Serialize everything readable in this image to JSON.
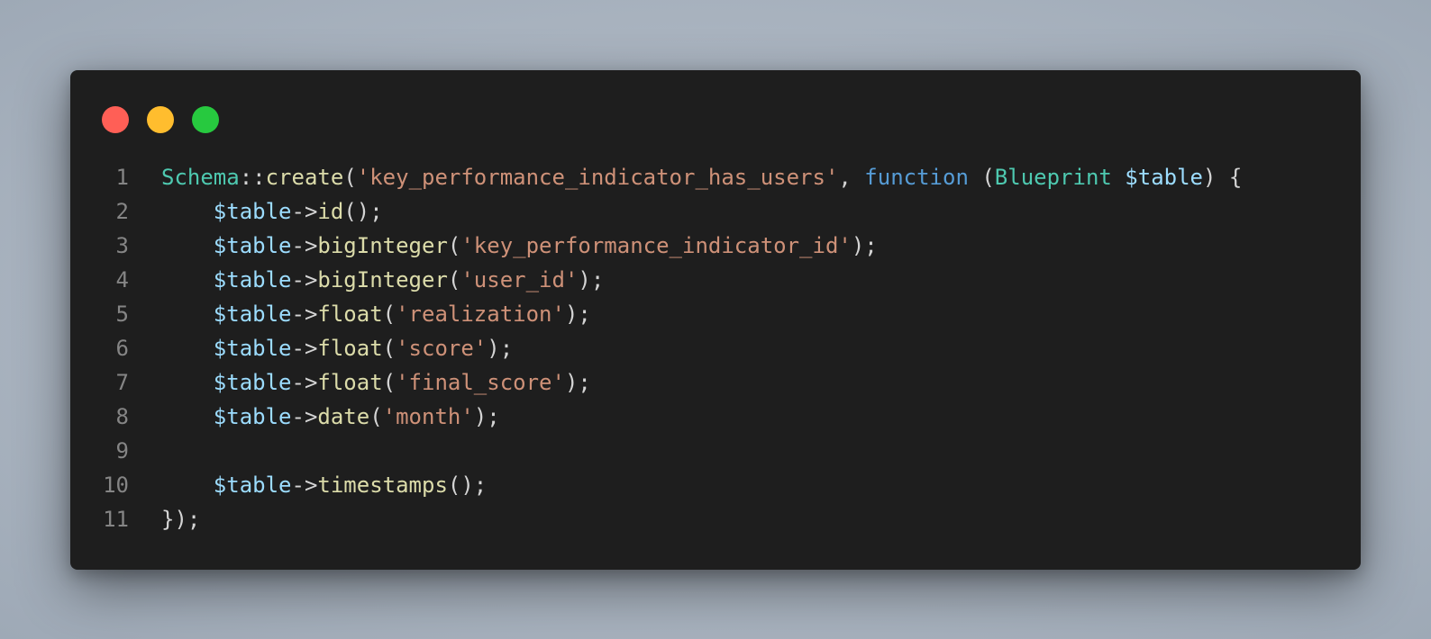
{
  "window": {
    "controls": [
      {
        "name": "close",
        "color": "#ff5f56"
      },
      {
        "name": "minimize",
        "color": "#ffbd2e"
      },
      {
        "name": "maximize",
        "color": "#27c93f"
      }
    ]
  },
  "colors": {
    "background": "#1e1e1e",
    "class": "#4ec9b0",
    "function": "#dcdcaa",
    "string": "#ce9178",
    "keyword": "#569cd6",
    "variable": "#9cdcfe",
    "punctuation": "#d4d4d4",
    "line_number": "#858585"
  },
  "code": {
    "lines": [
      {
        "number": "1",
        "tokens": [
          {
            "t": "class",
            "v": "Schema"
          },
          {
            "t": "punct",
            "v": "::"
          },
          {
            "t": "func",
            "v": "create"
          },
          {
            "t": "punct",
            "v": "("
          },
          {
            "t": "str",
            "v": "'key_performance_indicator_has_users'"
          },
          {
            "t": "punct",
            "v": ", "
          },
          {
            "t": "kw",
            "v": "function"
          },
          {
            "t": "punct",
            "v": " ("
          },
          {
            "t": "class",
            "v": "Blueprint"
          },
          {
            "t": "punct",
            "v": " "
          },
          {
            "t": "var",
            "v": "$table"
          },
          {
            "t": "punct",
            "v": ") {"
          }
        ]
      },
      {
        "number": "2",
        "tokens": [
          {
            "t": "punct",
            "v": "    "
          },
          {
            "t": "var",
            "v": "$table"
          },
          {
            "t": "punct",
            "v": "->"
          },
          {
            "t": "func",
            "v": "id"
          },
          {
            "t": "punct",
            "v": "();"
          }
        ]
      },
      {
        "number": "3",
        "tokens": [
          {
            "t": "punct",
            "v": "    "
          },
          {
            "t": "var",
            "v": "$table"
          },
          {
            "t": "punct",
            "v": "->"
          },
          {
            "t": "func",
            "v": "bigInteger"
          },
          {
            "t": "punct",
            "v": "("
          },
          {
            "t": "str",
            "v": "'key_performance_indicator_id'"
          },
          {
            "t": "punct",
            "v": ");"
          }
        ]
      },
      {
        "number": "4",
        "tokens": [
          {
            "t": "punct",
            "v": "    "
          },
          {
            "t": "var",
            "v": "$table"
          },
          {
            "t": "punct",
            "v": "->"
          },
          {
            "t": "func",
            "v": "bigInteger"
          },
          {
            "t": "punct",
            "v": "("
          },
          {
            "t": "str",
            "v": "'user_id'"
          },
          {
            "t": "punct",
            "v": ");"
          }
        ]
      },
      {
        "number": "5",
        "tokens": [
          {
            "t": "punct",
            "v": "    "
          },
          {
            "t": "var",
            "v": "$table"
          },
          {
            "t": "punct",
            "v": "->"
          },
          {
            "t": "func",
            "v": "float"
          },
          {
            "t": "punct",
            "v": "("
          },
          {
            "t": "str",
            "v": "'realization'"
          },
          {
            "t": "punct",
            "v": ");"
          }
        ]
      },
      {
        "number": "6",
        "tokens": [
          {
            "t": "punct",
            "v": "    "
          },
          {
            "t": "var",
            "v": "$table"
          },
          {
            "t": "punct",
            "v": "->"
          },
          {
            "t": "func",
            "v": "float"
          },
          {
            "t": "punct",
            "v": "("
          },
          {
            "t": "str",
            "v": "'score'"
          },
          {
            "t": "punct",
            "v": ");"
          }
        ]
      },
      {
        "number": "7",
        "tokens": [
          {
            "t": "punct",
            "v": "    "
          },
          {
            "t": "var",
            "v": "$table"
          },
          {
            "t": "punct",
            "v": "->"
          },
          {
            "t": "func",
            "v": "float"
          },
          {
            "t": "punct",
            "v": "("
          },
          {
            "t": "str",
            "v": "'final_score'"
          },
          {
            "t": "punct",
            "v": ");"
          }
        ]
      },
      {
        "number": "8",
        "tokens": [
          {
            "t": "punct",
            "v": "    "
          },
          {
            "t": "var",
            "v": "$table"
          },
          {
            "t": "punct",
            "v": "->"
          },
          {
            "t": "func",
            "v": "date"
          },
          {
            "t": "punct",
            "v": "("
          },
          {
            "t": "str",
            "v": "'month'"
          },
          {
            "t": "punct",
            "v": ");"
          }
        ]
      },
      {
        "number": "9",
        "tokens": []
      },
      {
        "number": "10",
        "tokens": [
          {
            "t": "punct",
            "v": "    "
          },
          {
            "t": "var",
            "v": "$table"
          },
          {
            "t": "punct",
            "v": "->"
          },
          {
            "t": "func",
            "v": "timestamps"
          },
          {
            "t": "punct",
            "v": "();"
          }
        ]
      },
      {
        "number": "11",
        "tokens": [
          {
            "t": "punct",
            "v": "});"
          }
        ]
      }
    ]
  }
}
